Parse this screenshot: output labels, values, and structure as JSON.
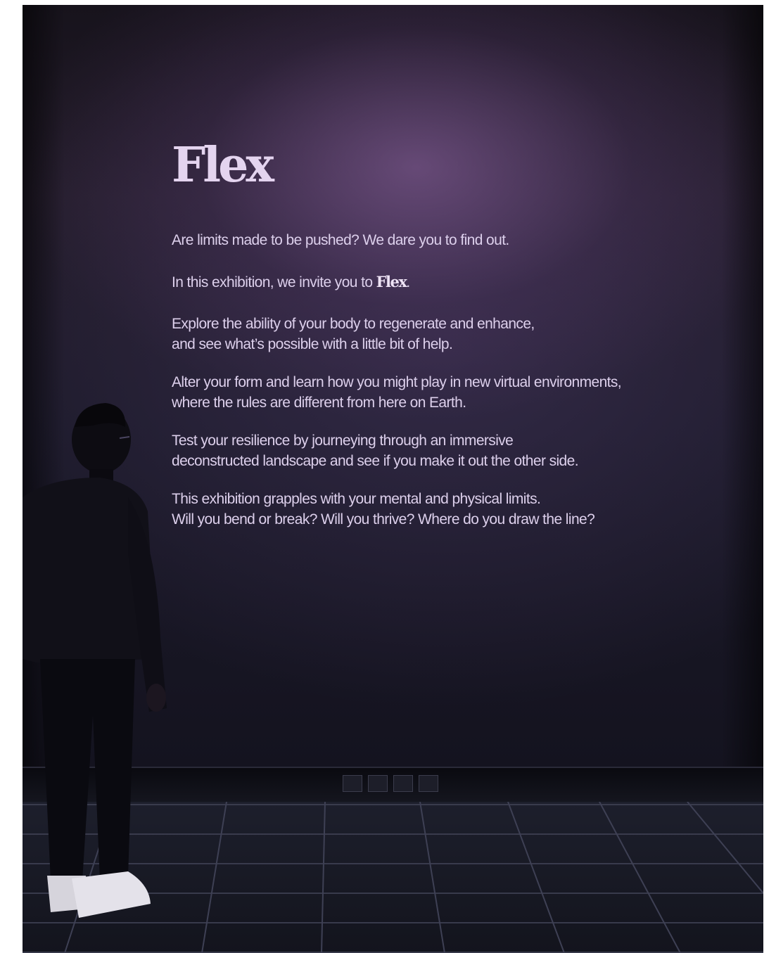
{
  "sign": {
    "title": "Flex",
    "paragraphs": [
      {
        "lines": [
          "Are limits made to be pushed? We dare you to find out."
        ]
      },
      {
        "lines": [
          "In this exhibition, we invite you to "
        ],
        "emphasis": "Flex",
        "suffix": "."
      },
      {
        "lines": [
          "Explore the ability of your body to regenerate and enhance,",
          "and see what’s possible with a little bit of help."
        ]
      },
      {
        "lines": [
          "Alter your form and learn how you might play in new virtual environments,",
          "where the rules are different from here on Earth."
        ]
      },
      {
        "lines": [
          "Test your resilience by journeying through an immersive",
          "deconstructed landscape and see if you make it out the other side."
        ]
      },
      {
        "lines": [
          "This exhibition grapples with your mental and physical limits.",
          "Will you bend or break? Will you thrive? Where do you draw the line?"
        ]
      }
    ]
  },
  "colors": {
    "wall": "#1c1a2a",
    "text": "#ddd0ec",
    "highlight": "#9669aa"
  }
}
